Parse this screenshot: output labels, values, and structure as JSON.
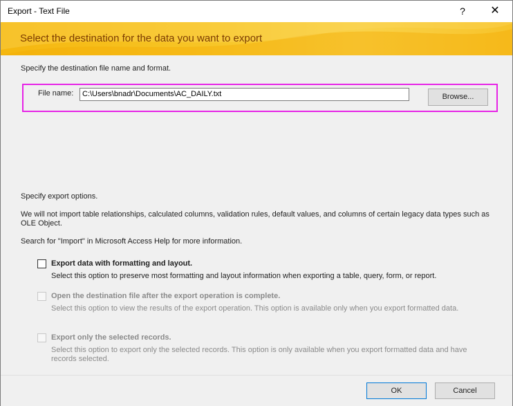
{
  "window": {
    "title": "Export - Text File",
    "help_glyph": "?",
    "close_glyph": "✕"
  },
  "banner": {
    "text": "Select the destination for the data you want to export"
  },
  "destination": {
    "instruction": "Specify the destination file name and format.",
    "file_name_label": "File name:",
    "file_name_value": "C:\\Users\\bnadr\\Documents\\AC_DAILY.txt",
    "browse_label": "Browse..."
  },
  "options": {
    "heading": "Specify export options.",
    "note": "We will not import table relationships, calculated columns, validation rules, default values, and columns of certain legacy data types such as OLE Object.",
    "help_note": "Search for \"Import\" in Microsoft Access Help for more information.",
    "items": [
      {
        "label": "Export data with formatting and layout.",
        "desc": "Select this option to preserve most formatting and layout information when exporting a table, query, form, or report.",
        "checked": false,
        "enabled": true
      },
      {
        "label": "Open the destination file after the export operation is complete.",
        "desc": "Select this option to view the results of the export operation. This option is available only when you export formatted data.",
        "checked": false,
        "enabled": false
      },
      {
        "label": "Export only the selected records.",
        "desc": "Select this option to export only the selected records. This option is only available when you export formatted data and have records selected.",
        "checked": false,
        "enabled": false
      }
    ]
  },
  "footer": {
    "ok_label": "OK",
    "cancel_label": "Cancel"
  },
  "colors": {
    "banner": "#f7c526",
    "banner_text": "#7b3b00",
    "highlight": "#e623e6"
  }
}
